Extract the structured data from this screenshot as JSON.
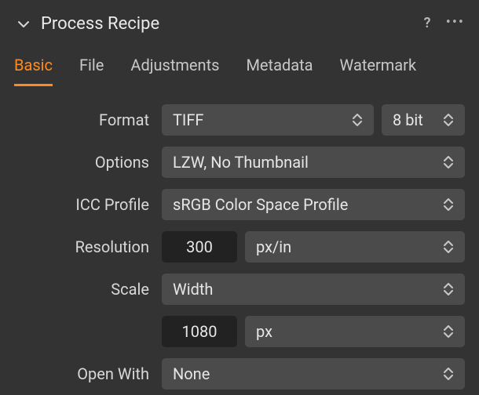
{
  "header": {
    "title": "Process Recipe"
  },
  "tabs": {
    "basic": "Basic",
    "file": "File",
    "adjustments": "Adjustments",
    "metadata": "Metadata",
    "watermark": "Watermark"
  },
  "labels": {
    "format": "Format",
    "options": "Options",
    "icc": "ICC Profile",
    "resolution": "Resolution",
    "scale": "Scale",
    "openwith": "Open With"
  },
  "values": {
    "format": "TIFF",
    "bitdepth": "8 bit",
    "options": "LZW, No Thumbnail",
    "icc": "sRGB Color Space Profile",
    "resolution": "300",
    "res_unit": "px/in",
    "scale_mode": "Width",
    "scale_value": "1080",
    "scale_unit": "px",
    "openwith": "None"
  }
}
